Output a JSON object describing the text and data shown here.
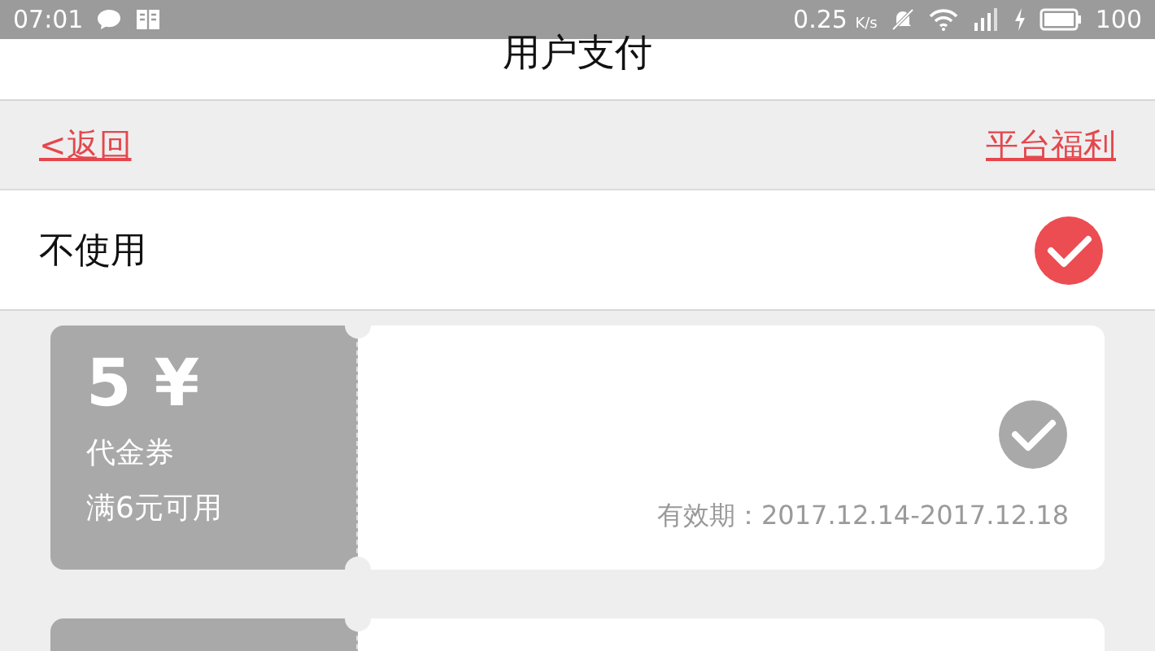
{
  "status_bar": {
    "time": "07:01",
    "speed": "0.25",
    "speed_unit": "K/s",
    "battery": "100"
  },
  "title": "用户支付",
  "nav": {
    "back": "<返回",
    "action": "平台福利"
  },
  "no_use": {
    "label": "不使用",
    "selected": true
  },
  "coupons": [
    {
      "kind": "coupon",
      "amount": "5",
      "currency": "¥",
      "type": "代金券",
      "condition": "满6元可用",
      "validity": "有效期：2017.12.14-2017.12.18",
      "selected": false
    },
    {
      "kind": "cut_off"
    }
  ]
}
